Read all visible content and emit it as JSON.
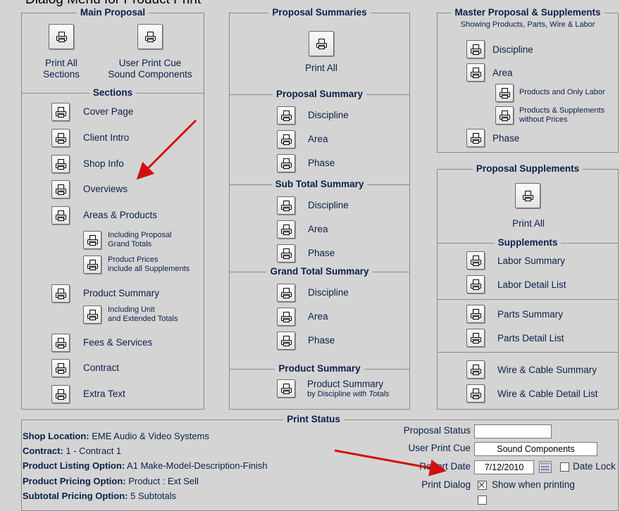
{
  "top_caption": "Dialog Menu for Product Print",
  "colors": {
    "bg": "#d4d4d4",
    "text": "#0c1f4a",
    "arrow": "#d01010",
    "border": "#8a8a8a"
  },
  "icons": {
    "print": "printer-icon",
    "calendar": "calendar-icon"
  },
  "main_proposal": {
    "title": "Main Proposal",
    "print_all": [
      "Print All",
      "Sections"
    ],
    "user_print_cue": [
      "User Print Cue",
      "Sound Components"
    ],
    "sections_title": "Sections",
    "sections": [
      {
        "label": "Cover Page"
      },
      {
        "label": "Client Intro"
      },
      {
        "label": "Shop Info"
      },
      {
        "label": "Overviews"
      },
      {
        "label": "Areas & Products"
      },
      {
        "sub": [
          "Including Proposal",
          "Grand Totals"
        ]
      },
      {
        "sub": [
          "Product Prices",
          "include all Supplements"
        ]
      },
      {
        "label": "Product Summary"
      },
      {
        "sub": [
          "Including Unit",
          "and Extended Totals"
        ]
      },
      {
        "label": "Fees & Services"
      },
      {
        "label": "Contract"
      },
      {
        "label": "Extra Text"
      }
    ]
  },
  "proposal_summaries": {
    "title": "Proposal Summaries",
    "print_all": "Print All",
    "groups": [
      {
        "title": "Proposal Summary",
        "items": [
          "Discipline",
          "Area",
          "Phase"
        ]
      },
      {
        "title": "Sub Total Summary",
        "items": [
          "Discipline",
          "Area",
          "Phase"
        ]
      },
      {
        "title": "Grand Total Summary",
        "items": [
          "Discipline",
          "Area",
          "Phase"
        ]
      }
    ],
    "product_summary": {
      "title": "Product Summary",
      "line1": "Product Summary",
      "line2_prefix": "by Discipline ",
      "line2_em": "with Totals"
    }
  },
  "master": {
    "title": "Master Proposal & Supplements",
    "subtitle": "Showing Products, Parts, Wire & Labor",
    "items": [
      "Discipline",
      "Area"
    ],
    "sub_items": [
      [
        "Products and Only Labor"
      ],
      [
        "Products & Supplements",
        "without Prices"
      ]
    ],
    "phase": "Phase"
  },
  "supplements": {
    "title": "Proposal Supplements",
    "print_all": "Print All",
    "sub_title": "Supplements",
    "items": [
      "Labor Summary",
      "Labor Detail List",
      "Parts Summary",
      "Parts Detail List",
      "Wire & Cable Summary",
      "Wire & Cable Detail List"
    ]
  },
  "print_status": {
    "title": "Print Status",
    "lines": [
      {
        "k": "Shop Location:",
        "v": " EME Audio & Video Systems"
      },
      {
        "k": "Contract:",
        "v": " 1 - Contract 1"
      },
      {
        "k": "Product Listing Option:",
        "v": " A1 Make-Model-Description-Finish"
      },
      {
        "k": "Product Pricing Option:",
        "v": " Product : Ext Sell"
      },
      {
        "k": "Subtotal Pricing Option:",
        "v": " 5 Subtotals"
      }
    ],
    "proposal_status_label": "Proposal Status",
    "proposal_status_value": "",
    "user_print_cue_label": "User Print Cue",
    "user_print_cue_value": "Sound Components",
    "report_date_label": "Report Date",
    "report_date_value": "7/12/2010",
    "date_lock_label": "Date Lock",
    "date_lock_checked": false,
    "print_dialog_label": "Print Dialog",
    "print_dialog_option": "Show when printing",
    "print_dialog_checked": true
  }
}
